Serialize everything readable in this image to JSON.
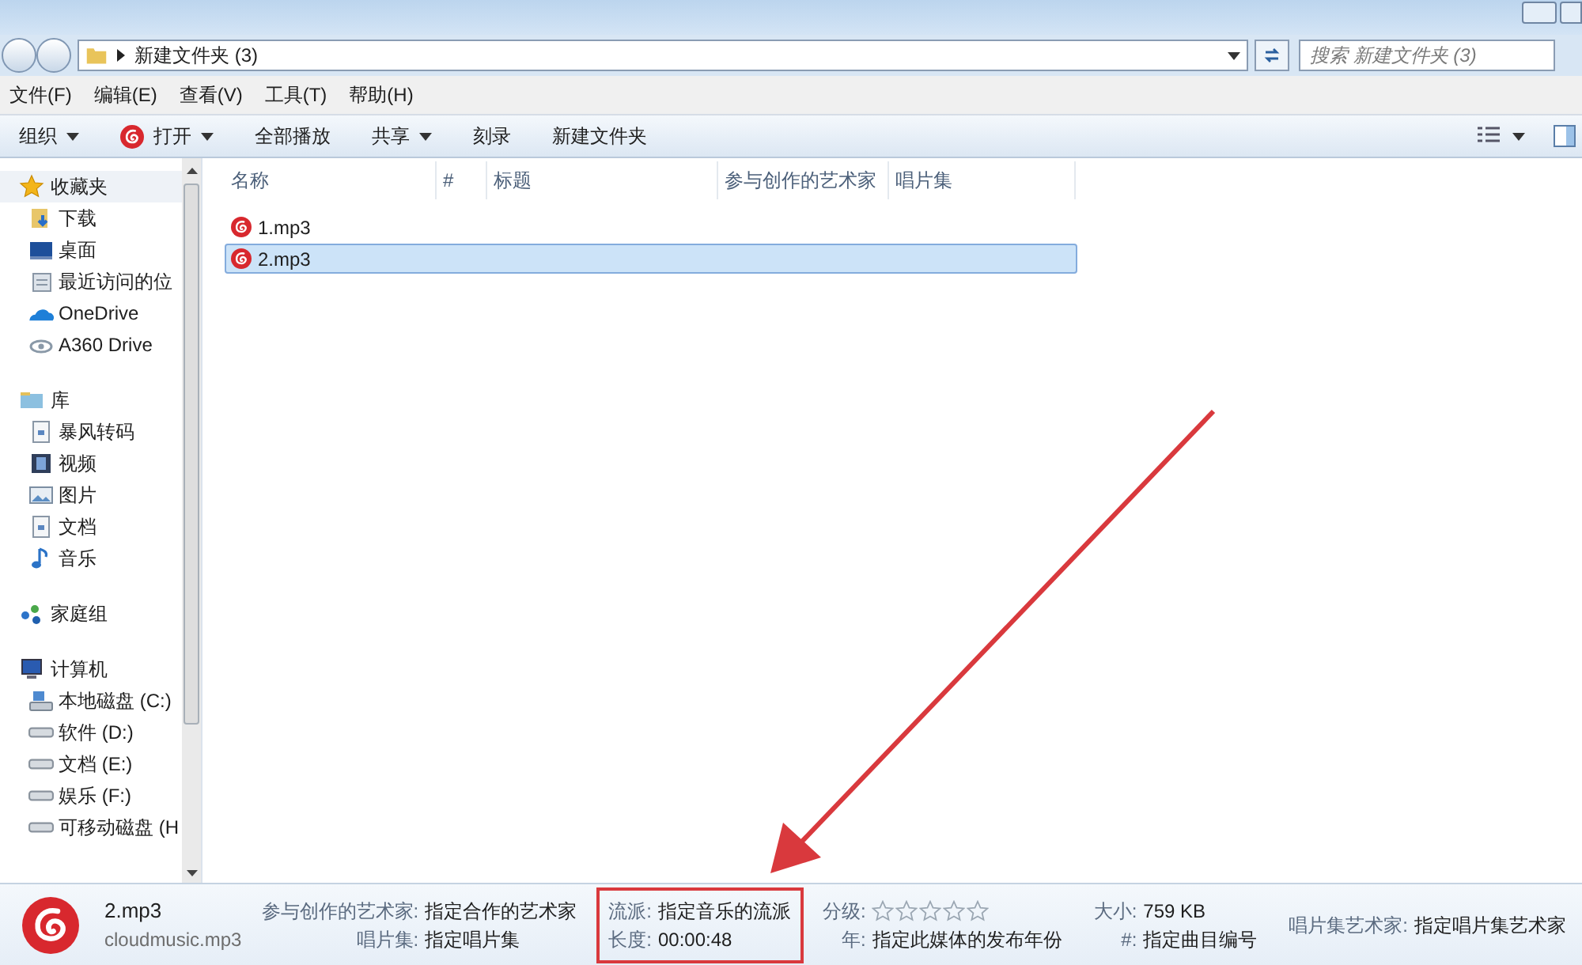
{
  "address_bar": {
    "path": "新建文件夹 (3)",
    "search_placeholder": "搜索 新建文件夹 (3)"
  },
  "menu": [
    "文件(F)",
    "编辑(E)",
    "查看(V)",
    "工具(T)",
    "帮助(H)"
  ],
  "toolbar": [
    {
      "label": "组织",
      "kind": "dropdown"
    },
    {
      "label": "打开",
      "kind": "app-dropdown"
    },
    {
      "label": "全部播放",
      "kind": "plain"
    },
    {
      "label": "共享",
      "kind": "dropdown"
    },
    {
      "label": "刻录",
      "kind": "plain"
    },
    {
      "label": "新建文件夹",
      "kind": "plain"
    }
  ],
  "sidebar": [
    {
      "label": "收藏夹",
      "kind": "star",
      "children": [
        {
          "label": "下载",
          "kind": "download"
        },
        {
          "label": "桌面",
          "kind": "desktop"
        },
        {
          "label": "最近访问的位",
          "kind": "recent"
        },
        {
          "label": "OneDrive",
          "kind": "cloud"
        },
        {
          "label": "A360 Drive",
          "kind": "eye"
        }
      ]
    },
    {
      "label": "库",
      "kind": "library",
      "children": [
        {
          "label": "暴风转码",
          "kind": "doc"
        },
        {
          "label": "视频",
          "kind": "video"
        },
        {
          "label": "图片",
          "kind": "picture"
        },
        {
          "label": "文档",
          "kind": "doc"
        },
        {
          "label": "音乐",
          "kind": "music"
        }
      ]
    },
    {
      "label": "家庭组",
      "kind": "homegroup"
    },
    {
      "label": "计算机",
      "kind": "computer",
      "children": [
        {
          "label": "本地磁盘 (C:)",
          "kind": "system-disk"
        },
        {
          "label": "软件 (D:)",
          "kind": "disk"
        },
        {
          "label": "文档 (E:)",
          "kind": "disk"
        },
        {
          "label": "娱乐 (F:)",
          "kind": "disk"
        },
        {
          "label": "可移动磁盘 (H",
          "kind": "disk"
        }
      ]
    }
  ],
  "table": {
    "columns": [
      "名称",
      "#",
      "标题",
      "参与创作的艺术家",
      "唱片集"
    ],
    "rows": [
      {
        "name": "1.mp3",
        "selected": false
      },
      {
        "name": "2.mp3",
        "selected": true
      }
    ]
  },
  "details": {
    "name": "2.mp3",
    "type": "cloudmusic.mp3",
    "columns": [
      {
        "highlighted": false,
        "fields": [
          {
            "label": "参与创作的艺术家:",
            "value": "指定合作的艺术家"
          },
          {
            "label": "唱片集:",
            "value": "指定唱片集"
          }
        ]
      },
      {
        "highlighted": true,
        "fields": [
          {
            "label": "流派:",
            "value": "指定音乐的流派"
          },
          {
            "label": "长度:",
            "value": "00:00:48"
          }
        ]
      },
      {
        "highlighted": false,
        "fields": [
          {
            "label": "分级:",
            "stars": 0
          },
          {
            "label": "年:",
            "value": "指定此媒体的发布年份"
          }
        ]
      },
      {
        "highlighted": false,
        "fields": [
          {
            "label": "大小:",
            "value": "759 KB"
          },
          {
            "label": "#:",
            "value": "指定曲目编号"
          }
        ]
      },
      {
        "highlighted": false,
        "fields": [
          {
            "label": "唱片集艺术家:",
            "value": "指定唱片集艺术家"
          }
        ]
      }
    ]
  }
}
